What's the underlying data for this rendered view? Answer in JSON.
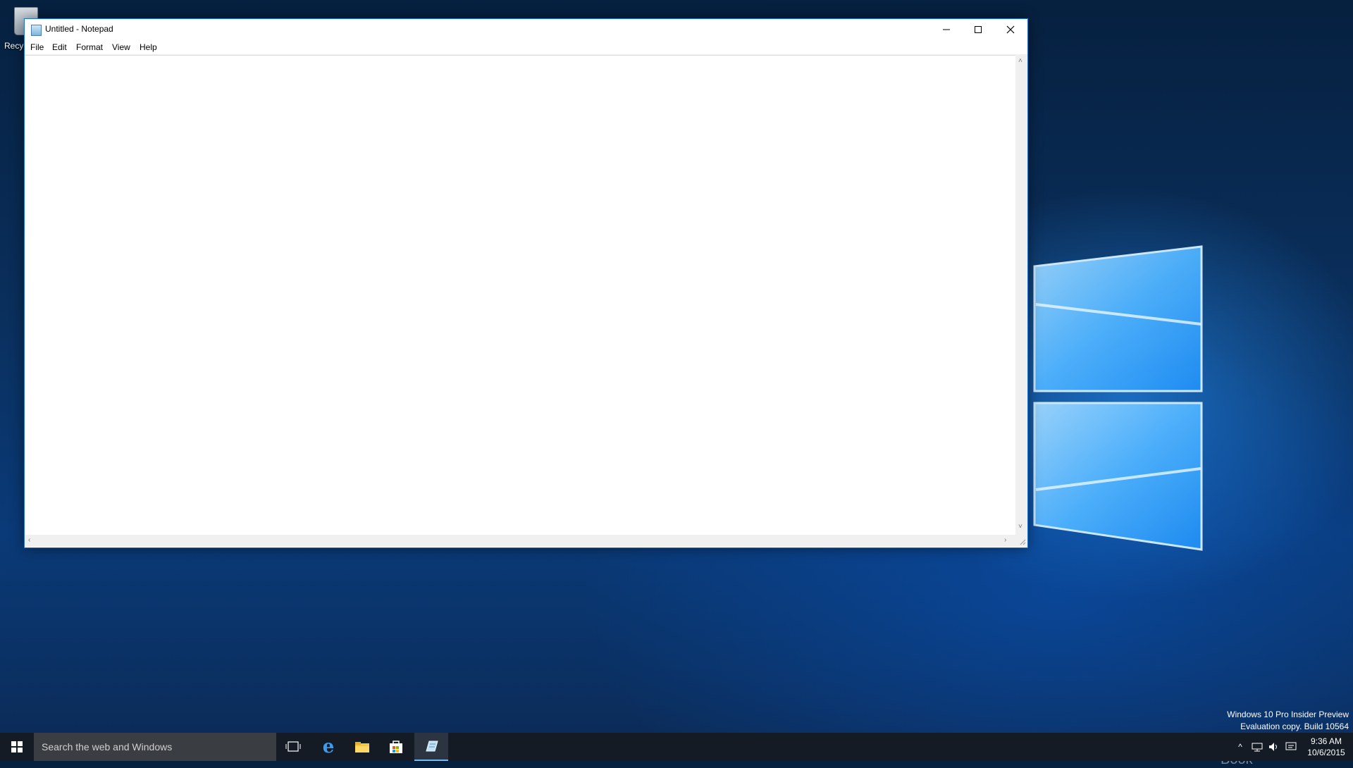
{
  "desktop": {
    "recycle_bin_label": "Recy",
    "watermark": {
      "line1": "Windows 10 Pro Insider Preview",
      "line2": "Evaluation copy. Build 10564"
    },
    "brand_text": "The Collection Book"
  },
  "notepad": {
    "title": "Untitled - Notepad",
    "menu": [
      "File",
      "Edit",
      "Format",
      "View",
      "Help"
    ],
    "content": ""
  },
  "taskbar": {
    "search_placeholder": "Search the web and Windows",
    "time": "9:36 AM",
    "date": "10/6/2015"
  },
  "colors": {
    "accent": "#1a73c9",
    "taskbar": "#141b24",
    "search_box": "#3a3d42"
  }
}
